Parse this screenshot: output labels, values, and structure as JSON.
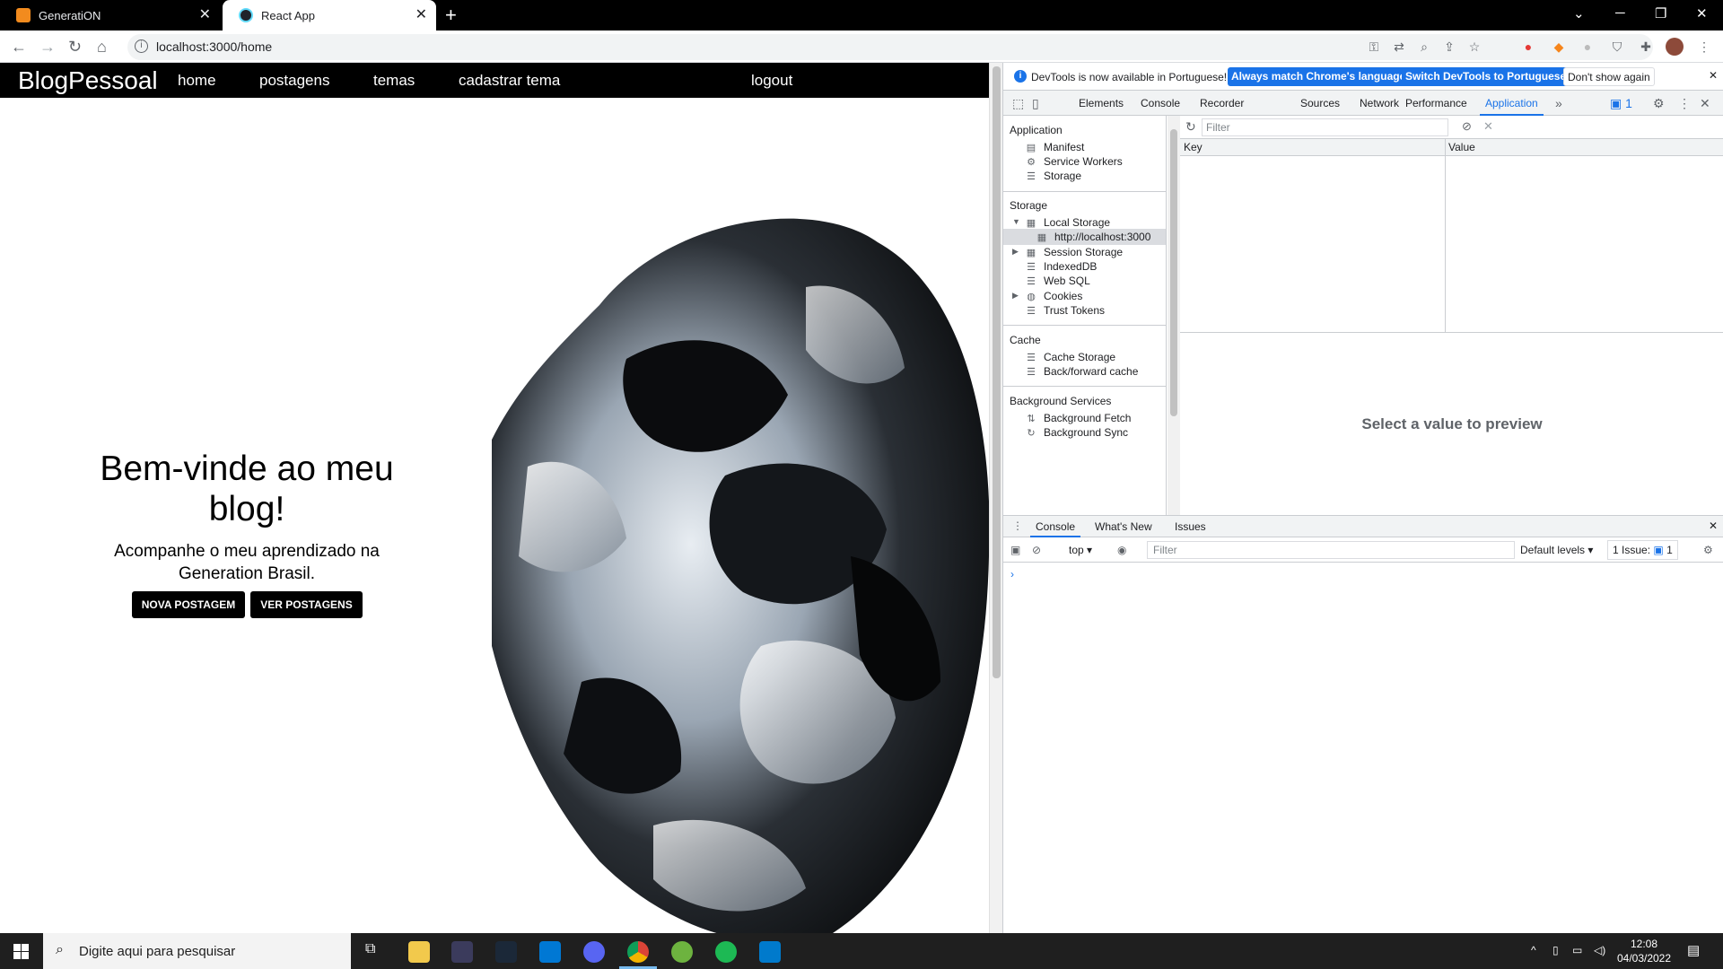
{
  "browser": {
    "tabs": [
      {
        "title": "GeneratiON",
        "active": false
      },
      {
        "title": "React App",
        "active": true
      }
    ],
    "url": "localhost:3000/home"
  },
  "app": {
    "brand": "BlogPessoal",
    "nav": [
      "home",
      "postagens",
      "temas",
      "cadastrar tema"
    ],
    "logout": "logout",
    "hero_title": "Bem-vinde ao meu blog!",
    "hero_subtitle": "Acompanhe o meu aprendizado na Generation Brasil.",
    "btn_new": "NOVA POSTAGEM",
    "btn_view": "VER POSTAGENS"
  },
  "devtools": {
    "infobar": {
      "message": "DevTools is now available in Portuguese!",
      "btn_match": "Always match Chrome's language",
      "btn_switch": "Switch DevTools to Portuguese",
      "btn_dismiss": "Don't show again"
    },
    "tabs": [
      "Elements",
      "Console",
      "Recorder",
      "Sources",
      "Network",
      "Performance",
      "Application"
    ],
    "active_tab": "Application",
    "issues_badge": "1",
    "sidebar": {
      "application_header": "Application",
      "application_items": [
        "Manifest",
        "Service Workers",
        "Storage"
      ],
      "storage_header": "Storage",
      "local_storage": "Local Storage",
      "local_storage_child": "http://localhost:3000",
      "storage_items": [
        "Session Storage",
        "IndexedDB",
        "Web SQL",
        "Cookies",
        "Trust Tokens"
      ],
      "cache_header": "Cache",
      "cache_items": [
        "Cache Storage",
        "Back/forward cache"
      ],
      "bg_header": "Background Services",
      "bg_items": [
        "Background Fetch",
        "Background Sync"
      ]
    },
    "storage_filter_placeholder": "Filter",
    "table_headers": {
      "key": "Key",
      "value": "Value"
    },
    "preview_text": "Select a value to preview",
    "drawer_tabs": [
      "Console",
      "What's New",
      "Issues"
    ],
    "console": {
      "context": "top",
      "filter_placeholder": "Filter",
      "levels": "Default levels",
      "issues": "1 Issue:",
      "issues_count": "1"
    }
  },
  "taskbar": {
    "search_placeholder": "Digite aqui para pesquisar",
    "time": "12:08",
    "date": "04/03/2022"
  }
}
